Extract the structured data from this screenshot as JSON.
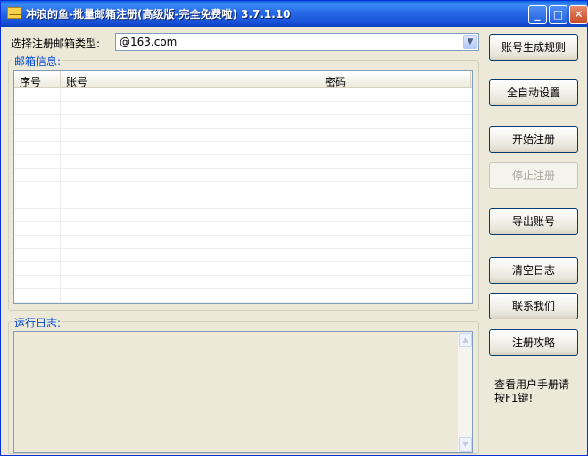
{
  "window": {
    "title": "冲浪的鱼-批量邮箱注册(高级版-完全免费啦) 3.7.1.10",
    "controls": {
      "minimize": "_",
      "maximize": "□",
      "close": "✕"
    }
  },
  "email_type": {
    "label": "选择注册邮箱类型:",
    "selected": "@163.com"
  },
  "mailbox_group": {
    "legend": "邮箱信息:",
    "columns": [
      "序号",
      "账号",
      "密码"
    ]
  },
  "log_group": {
    "legend": "运行日志:"
  },
  "buttons": {
    "account_rules": "账号生成规则",
    "auto_settings": "全自动设置",
    "start": "开始注册",
    "stop": "停止注册",
    "export": "导出账号",
    "clear_log": "清空日志",
    "contact": "联系我们",
    "guide": "注册攻略"
  },
  "help_text": "查看用户手册请按F1键!",
  "icons": {
    "app": "envelope-icon",
    "dropdown": "chevron-down-icon",
    "scroll_up": "chevron-up-icon",
    "scroll_down": "chevron-down-icon"
  },
  "colors": {
    "titlebar": "#2769e6",
    "group_legend": "#0046d5",
    "window_bg": "#ece9d8"
  }
}
